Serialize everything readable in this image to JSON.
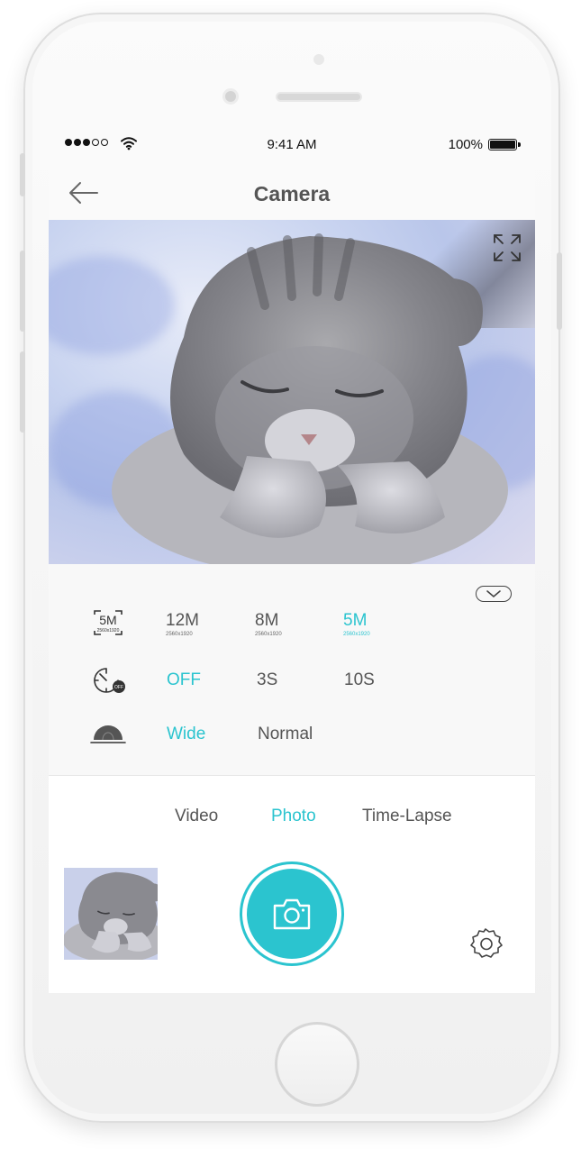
{
  "status_bar": {
    "time": "9:41 AM",
    "battery": "100%"
  },
  "nav": {
    "title": "Camera"
  },
  "settings": {
    "resolution": {
      "icon": "resolution-5m-icon",
      "icon_label": "5M",
      "icon_sub": "2560x1920",
      "options": [
        {
          "label": "12M",
          "sub": "2560x1920",
          "active": false
        },
        {
          "label": "8M",
          "sub": "2560x1920",
          "active": false
        },
        {
          "label": "5M",
          "sub": "2560x1920",
          "active": true
        }
      ]
    },
    "timer": {
      "icon": "timer-off-icon",
      "icon_badge": "OFF",
      "options": [
        {
          "label": "OFF",
          "active": true
        },
        {
          "label": "3S",
          "active": false
        },
        {
          "label": "10S",
          "active": false
        }
      ]
    },
    "lens": {
      "icon": "wide-angle-icon",
      "options": [
        {
          "label": "Wide",
          "active": true
        },
        {
          "label": "Normal",
          "active": false
        }
      ]
    }
  },
  "modes": [
    {
      "label": "Video",
      "active": false
    },
    {
      "label": "Photo",
      "active": true
    },
    {
      "label": "Time-Lapse",
      "active": false
    }
  ],
  "colors": {
    "accent": "#2bc4cf",
    "text": "#555555",
    "panel": "#f8f8f8"
  }
}
